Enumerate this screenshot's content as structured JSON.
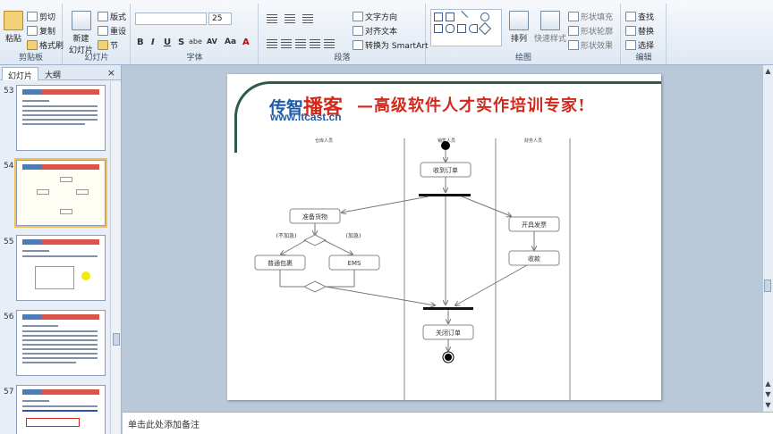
{
  "ribbon": {
    "clipboard": {
      "paste": "粘贴",
      "cut": "剪切",
      "copy": "复制",
      "format_painter": "格式刷",
      "label": "剪贴板"
    },
    "slides": {
      "new_slide": "新建\n幻灯片",
      "layout": "版式",
      "reset": "重设",
      "section": "节",
      "label": "幻灯片"
    },
    "font": {
      "size": "25",
      "bold": "B",
      "italic": "I",
      "underline": "U",
      "strike": "S",
      "shadow": "abe",
      "spacing": "AV",
      "case": "Aa",
      "color": "A",
      "label": "字体"
    },
    "paragraph": {
      "text_direction": "文字方向",
      "align_text": "对齐文本",
      "smartart": "转换为 SmartArt",
      "label": "段落"
    },
    "drawing": {
      "arrange": "排列",
      "quick_styles": "快速样式",
      "shape_fill": "形状填充",
      "shape_outline": "形状轮廓",
      "shape_effects": "形状效果",
      "label": "绘图"
    },
    "editing": {
      "find": "查找",
      "replace": "替换",
      "select": "选择",
      "label": "编辑"
    }
  },
  "panel": {
    "tabs": [
      {
        "label": "幻灯片"
      },
      {
        "label": "大纲"
      }
    ],
    "close": "×",
    "thumbs": [
      {
        "num": "53"
      },
      {
        "num": "54"
      },
      {
        "num": "55"
      },
      {
        "num": "56"
      },
      {
        "num": "57"
      }
    ]
  },
  "slide": {
    "logo_a": "传智",
    "logo_b": "播客",
    "site": "www.itcast.cn",
    "slogan": "—高级软件人才实作培训专家!",
    "lanes": [
      "仓库人员",
      "销售人员",
      "财务人员"
    ],
    "nodes": {
      "receive_order": "收到订单",
      "prepare_goods": "准备货物",
      "invoice": "开具发票",
      "no_urgent": "(不加急)",
      "urgent": "(加急)",
      "normal_ship": "普通包裹",
      "ems": "EMS",
      "collect": "收款",
      "close_order": "关闭订单"
    }
  },
  "notes": {
    "placeholder": "单击此处添加备注"
  },
  "colors": {
    "accent_yellow": "#f2ec00",
    "brand_blue": "#1f5ca8",
    "brand_red": "#d12a1c"
  }
}
